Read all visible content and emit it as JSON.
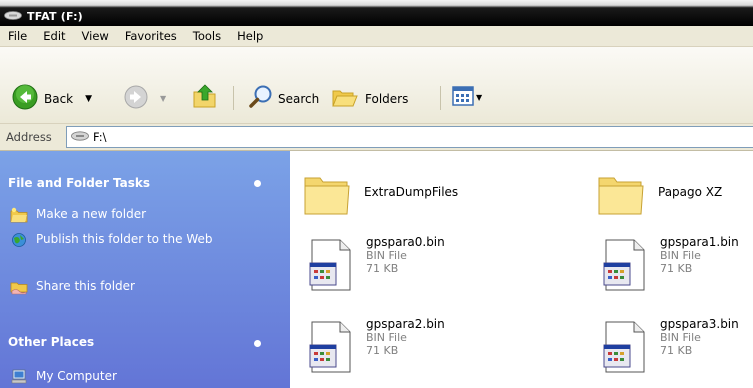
{
  "window": {
    "title": "TFAT (F:)"
  },
  "menu": [
    "File",
    "Edit",
    "View",
    "Favorites",
    "Tools",
    "Help"
  ],
  "toolbar": {
    "back_label": "Back",
    "search_label": "Search",
    "folders_label": "Folders"
  },
  "address": {
    "label": "Address",
    "value": "F:\\"
  },
  "task_pane": {
    "file_tasks": {
      "title": "File and Folder Tasks",
      "items": [
        {
          "label": "Make a new folder",
          "icon": "new-folder-icon"
        },
        {
          "label": "Publish this folder to the Web",
          "icon": "publish-web-icon"
        },
        {
          "label": "Share this folder",
          "icon": "share-folder-icon"
        }
      ]
    },
    "other_places": {
      "title": "Other Places",
      "items": [
        {
          "label": "My Computer",
          "icon": "my-computer-icon"
        }
      ]
    }
  },
  "files": [
    {
      "name": "ExtraDumpFiles",
      "kind": "folder"
    },
    {
      "name": "Papago XZ",
      "kind": "folder"
    },
    {
      "name": "gpspara0.bin",
      "type": "BIN File",
      "size": "71 KB",
      "kind": "file"
    },
    {
      "name": "gpspara1.bin",
      "type": "BIN File",
      "size": "71 KB",
      "kind": "file"
    },
    {
      "name": "gpspara2.bin",
      "type": "BIN File",
      "size": "71 KB",
      "kind": "file"
    },
    {
      "name": "gpspara3.bin",
      "type": "BIN File",
      "size": "71 KB",
      "kind": "file"
    }
  ],
  "colors": {
    "task_pane_top": "#7ba2e7",
    "task_pane_bottom": "#6375d6",
    "chrome": "#ece9d8"
  }
}
